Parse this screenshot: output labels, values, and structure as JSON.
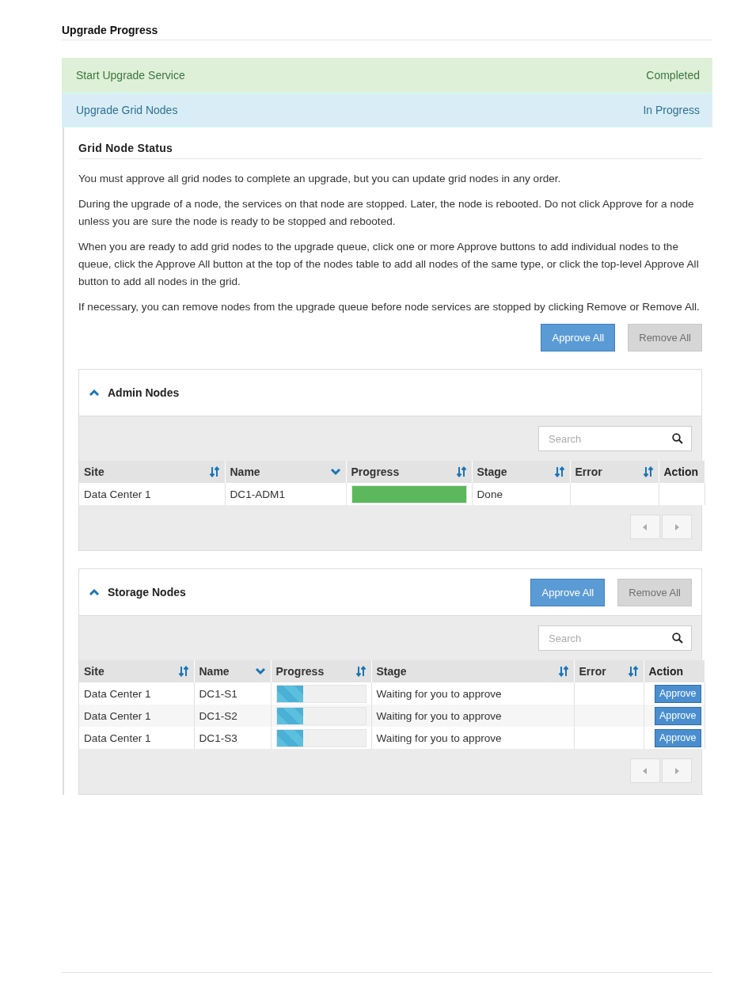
{
  "title": "Upgrade Progress",
  "steps": [
    {
      "label": "Start Upgrade Service",
      "status": "Completed",
      "kind": "completed"
    },
    {
      "label": "Upgrade Grid Nodes",
      "status": "In Progress",
      "kind": "active"
    }
  ],
  "section": {
    "title": "Grid Node Status",
    "paragraphs": [
      "You must approve all grid nodes to complete an upgrade, but you can update grid nodes in any order.",
      "During the upgrade of a node, the services on that node are stopped. Later, the node is rebooted. Do not click Approve for a node unless you are sure the node is ready to be stopped and rebooted.",
      "When you are ready to add grid nodes to the upgrade queue, click one or more Approve buttons to add individual nodes to the queue, click the Approve All button at the top of the nodes table to add all nodes of the same type, or click the top-level Approve All button to add all nodes in the grid.",
      "If necessary, you can remove nodes from the upgrade queue before node services are stopped by clicking Remove or Remove All."
    ],
    "buttons": [
      {
        "label": "Approve All",
        "disabled": false
      },
      {
        "label": "Remove All",
        "disabled": true
      }
    ]
  },
  "panels": [
    {
      "title": "Admin Nodes",
      "expanded": true,
      "search": {
        "placeholder": "Search"
      },
      "columns": [
        {
          "label": "Site",
          "sortable": true,
          "sorted": false
        },
        {
          "label": "Name",
          "sortable": true,
          "sorted": true
        },
        {
          "label": "Progress",
          "sortable": true,
          "sorted": false
        },
        {
          "label": "Stage",
          "sortable": true,
          "sorted": false
        },
        {
          "label": "Error",
          "sortable": true,
          "sorted": false
        },
        {
          "label": "Action",
          "sortable": false,
          "sorted": false
        }
      ],
      "rows": [
        {
          "site": "Data Center 1",
          "name": "DC1-ADM1",
          "level": 1,
          "stage": "Done"
        }
      ]
    },
    {
      "title": "Storage Nodes",
      "expanded": true,
      "buttons": [
        {
          "label": "Approve All",
          "disabled": false
        },
        {
          "label": "Remove All",
          "disabled": true
        }
      ],
      "search": {
        "placeholder": "Search"
      },
      "columns": [
        {
          "label": "Site",
          "sortable": true,
          "sorted": false
        },
        {
          "label": "Name",
          "sortable": true,
          "sorted": true
        },
        {
          "label": "Progress",
          "sortable": true,
          "sorted": false
        },
        {
          "label": "Stage",
          "sortable": true,
          "sorted": false
        },
        {
          "label": "Error",
          "sortable": true,
          "sorted": false
        },
        {
          "label": "Action",
          "sortable": false,
          "sorted": false
        }
      ],
      "rows": [
        {
          "site": "Data Center 1",
          "name": "DC1-S1",
          "level": 0.3,
          "stage": "Waiting for you to approve",
          "action": "Approve"
        },
        {
          "site": "Data Center 1",
          "name": "DC1-S2",
          "level": 0.3,
          "stage": "Waiting for you to approve",
          "action": "Approve"
        },
        {
          "site": "Data Center 1",
          "name": "DC1-S3",
          "level": 0.3,
          "stage": "Waiting for you to approve",
          "action": "Approve"
        }
      ]
    }
  ]
}
